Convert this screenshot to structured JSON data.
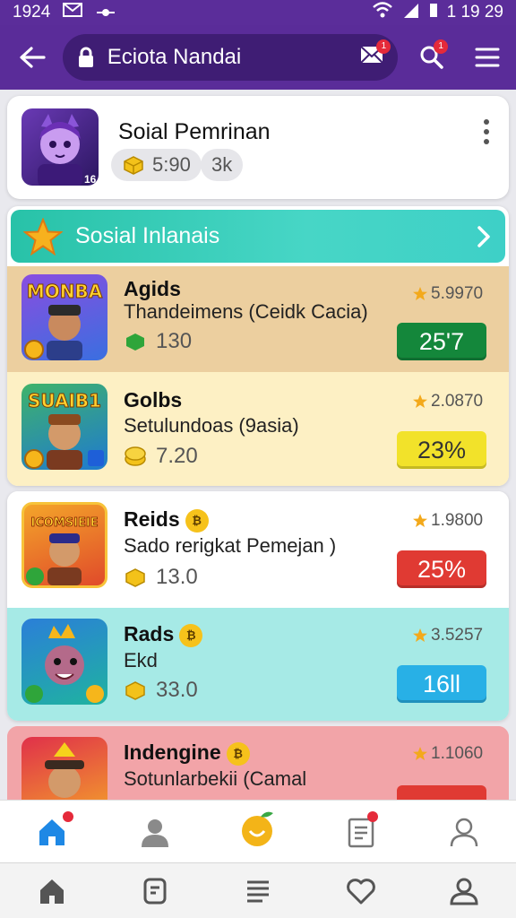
{
  "status_bar": {
    "time_left": "1924",
    "time_right": "1 19 29"
  },
  "app_bar": {
    "title": "Eciota Nandai",
    "mail_badge": "1",
    "search_badge": "1"
  },
  "profile": {
    "name": "Soial Pemrinan",
    "coins": "5:90",
    "count": "3k",
    "avatar_tag": "16"
  },
  "section": {
    "title": "Sosial Inlanais"
  },
  "games": [
    {
      "icon_text": "MONBA",
      "name": "Agids",
      "desc": "Thandeimens (Ceidk Cacia)",
      "coins": "130",
      "rating": "5.9970",
      "pct": "25'7",
      "bg": "#eccf9f",
      "btn": "#14873b"
    },
    {
      "icon_text": "SUAIB1",
      "name": "Golbs",
      "desc": "Setulundoas (9asia)",
      "coins": "7.20",
      "rating": "2.0870",
      "pct": "23%",
      "bg": "#fdf0c4",
      "btn": "#f2e22a"
    },
    {
      "icon_text": "ICOMSIEIE",
      "name": "Reids",
      "desc": "Sado rerigkat Pemejan )",
      "coins": "13.0",
      "rating": "1.9800",
      "pct": "25%",
      "bg": "#ffffff",
      "btn": "#e03a33"
    },
    {
      "icon_text": "",
      "name": "Rads",
      "desc": "Ekd",
      "coins": "33.0",
      "rating": "3.5257",
      "pct": "16ll",
      "bg": "#a6eae6",
      "btn": "#28b0e6"
    },
    {
      "icon_text": "",
      "name": "Indengine",
      "desc": "Sotunlarbekii (Camal",
      "coins": "",
      "rating": "1.1060",
      "pct": "",
      "bg": "#f2a4a8",
      "btn": "#e03a33"
    }
  ],
  "vip_label": "₿",
  "colors": {
    "purple": "#5a2c99",
    "teal": "#2fc8b4",
    "accent_orange": "#f08a1c"
  }
}
